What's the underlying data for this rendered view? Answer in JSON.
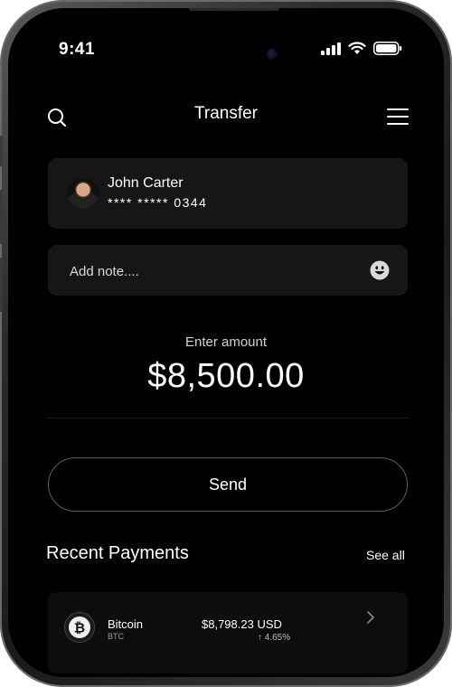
{
  "status_bar": {
    "time": "9:41",
    "signal_icon": "cellular-signal-icon",
    "wifi_icon": "wifi-icon",
    "battery_icon": "battery-icon"
  },
  "header": {
    "title": "Transfer",
    "search_icon": "search-icon",
    "menu_icon": "menu-icon"
  },
  "recipient": {
    "name": "John Carter",
    "card_number": "**** ***** 0344",
    "avatar_icon": "avatar"
  },
  "note": {
    "placeholder": "Add note....",
    "value": "",
    "emoji_icon": "emoji-icon"
  },
  "amount": {
    "label": "Enter amount",
    "value": "$8,500.00"
  },
  "actions": {
    "send_label": "Send"
  },
  "recent_payments": {
    "title": "Recent Payments",
    "see_all_label": "See all",
    "items": [
      {
        "name": "Bitcoin",
        "symbol": "BTC",
        "price": "$8,798.23  USD",
        "change": "↑ 4.65%",
        "icon": "bitcoin-icon"
      }
    ]
  },
  "colors": {
    "background": "#000000",
    "card": "#161617",
    "text": "#ffffff",
    "muted_text": "#d0d0d0",
    "button_border": "#5a5a5c"
  }
}
